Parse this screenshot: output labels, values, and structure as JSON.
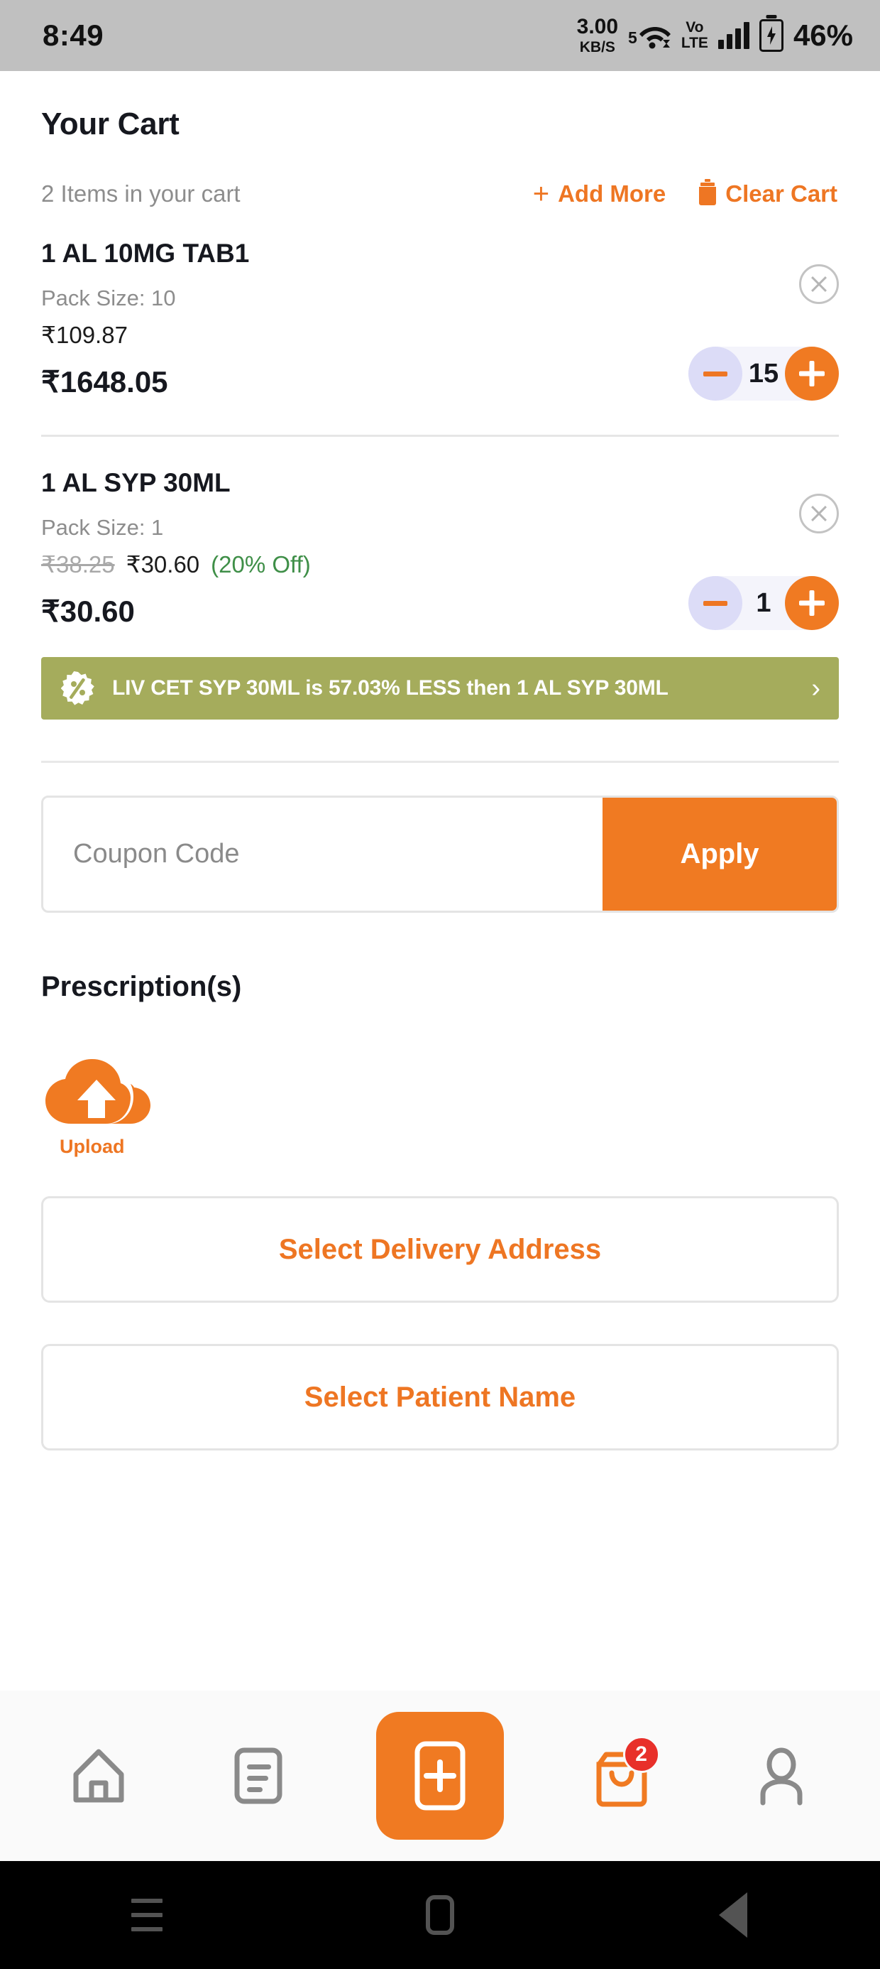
{
  "status_bar": {
    "time": "8:49",
    "net_rate_value": "3.00",
    "net_rate_unit": "KB/S",
    "wifi_label": "5",
    "volte_line1": "Vo",
    "volte_line2": "LTE",
    "battery_percent": "46%"
  },
  "header": {
    "title": "Your Cart",
    "cart_count_label": "2 Items in your cart",
    "add_more_label": "Add More",
    "add_more_plus": "+",
    "clear_cart_label": "Clear Cart"
  },
  "items": [
    {
      "name": "1 AL 10MG TAB1",
      "pack_size_label": "Pack Size: 10",
      "unit_price": "₹109.87",
      "mrp": "",
      "discount": "",
      "total_price": "₹1648.05",
      "quantity": "15"
    },
    {
      "name": "1 AL SYP 30ML",
      "pack_size_label": "Pack Size: 1",
      "unit_price": "₹30.60",
      "mrp": "₹38.25",
      "discount": "(20% Off)",
      "total_price": "₹30.60",
      "quantity": "1"
    }
  ],
  "promo_banner": {
    "text": "LIV CET SYP 30ML is 57.03% LESS then 1 AL SYP 30ML",
    "chevron": "›",
    "background_color": "#a5ac5c"
  },
  "coupon": {
    "placeholder": "Coupon Code",
    "value": "",
    "apply_label": "Apply"
  },
  "prescription": {
    "title": "Prescription(s)",
    "upload_label": "Upload"
  },
  "actions": {
    "select_address_label": "Select Delivery Address",
    "select_patient_label": "Select Patient Name"
  },
  "bottom_nav": {
    "cart_badge": "2"
  },
  "colors": {
    "accent_orange": "#f07a22",
    "link_orange": "#ee7623",
    "discount_green": "#3f8f48",
    "promo_olive": "#a5ac5c",
    "badge_red": "#e8302a"
  }
}
